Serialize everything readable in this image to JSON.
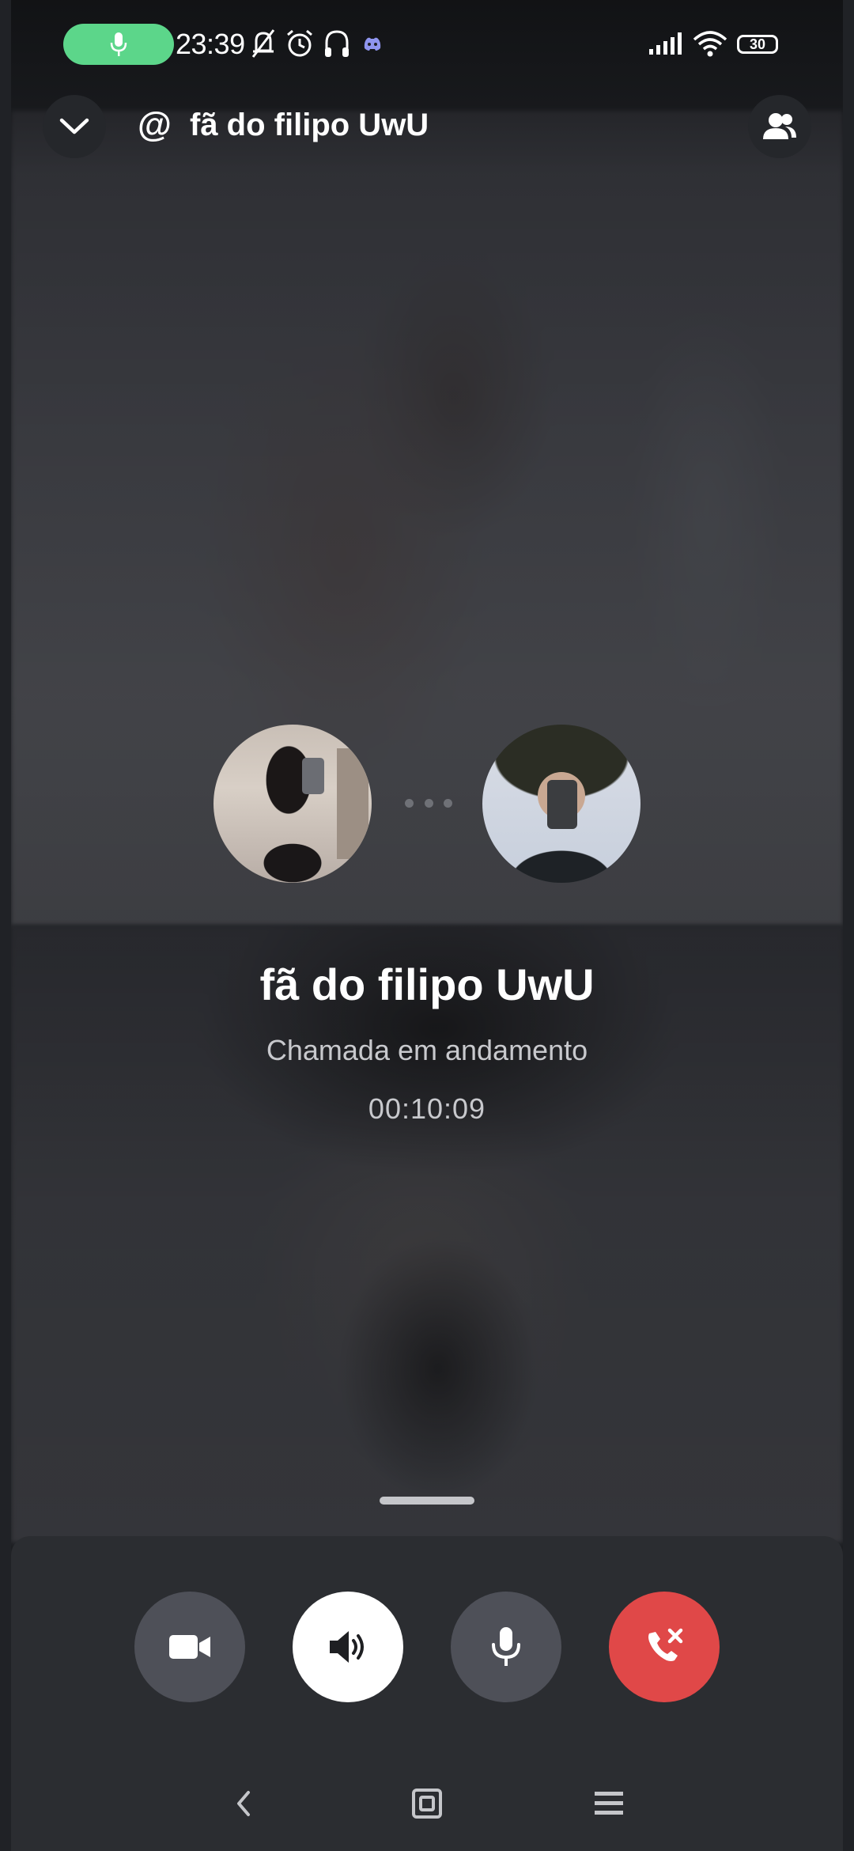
{
  "status_bar": {
    "time": "23:39",
    "battery_level": "30",
    "icons": [
      "mic-icon",
      "mute-bell-icon",
      "alarm-icon",
      "headphones-icon",
      "discord-icon",
      "signal-icon",
      "wifi-icon",
      "battery-icon"
    ]
  },
  "header": {
    "at_symbol": "@",
    "title": "fã do filipo UwU",
    "collapse_icon": "chevron-down-icon",
    "members_icon": "people-icon"
  },
  "call": {
    "name": "fã do filipo UwU",
    "status": "Chamada em andamento",
    "timer": "00:10:09"
  },
  "controls": [
    {
      "name": "camera-button",
      "icon": "video-camera-icon"
    },
    {
      "name": "speaker-button",
      "icon": "speaker-icon"
    },
    {
      "name": "microphone-button",
      "icon": "mic-icon"
    },
    {
      "name": "end-call-button",
      "icon": "hangup-icon"
    }
  ],
  "colors": {
    "accent_green": "#5cd68a",
    "end_call_red": "#e04848",
    "panel": "#2b2d31"
  },
  "nav_bar": [
    "back-icon",
    "home-icon",
    "menu-icon"
  ]
}
